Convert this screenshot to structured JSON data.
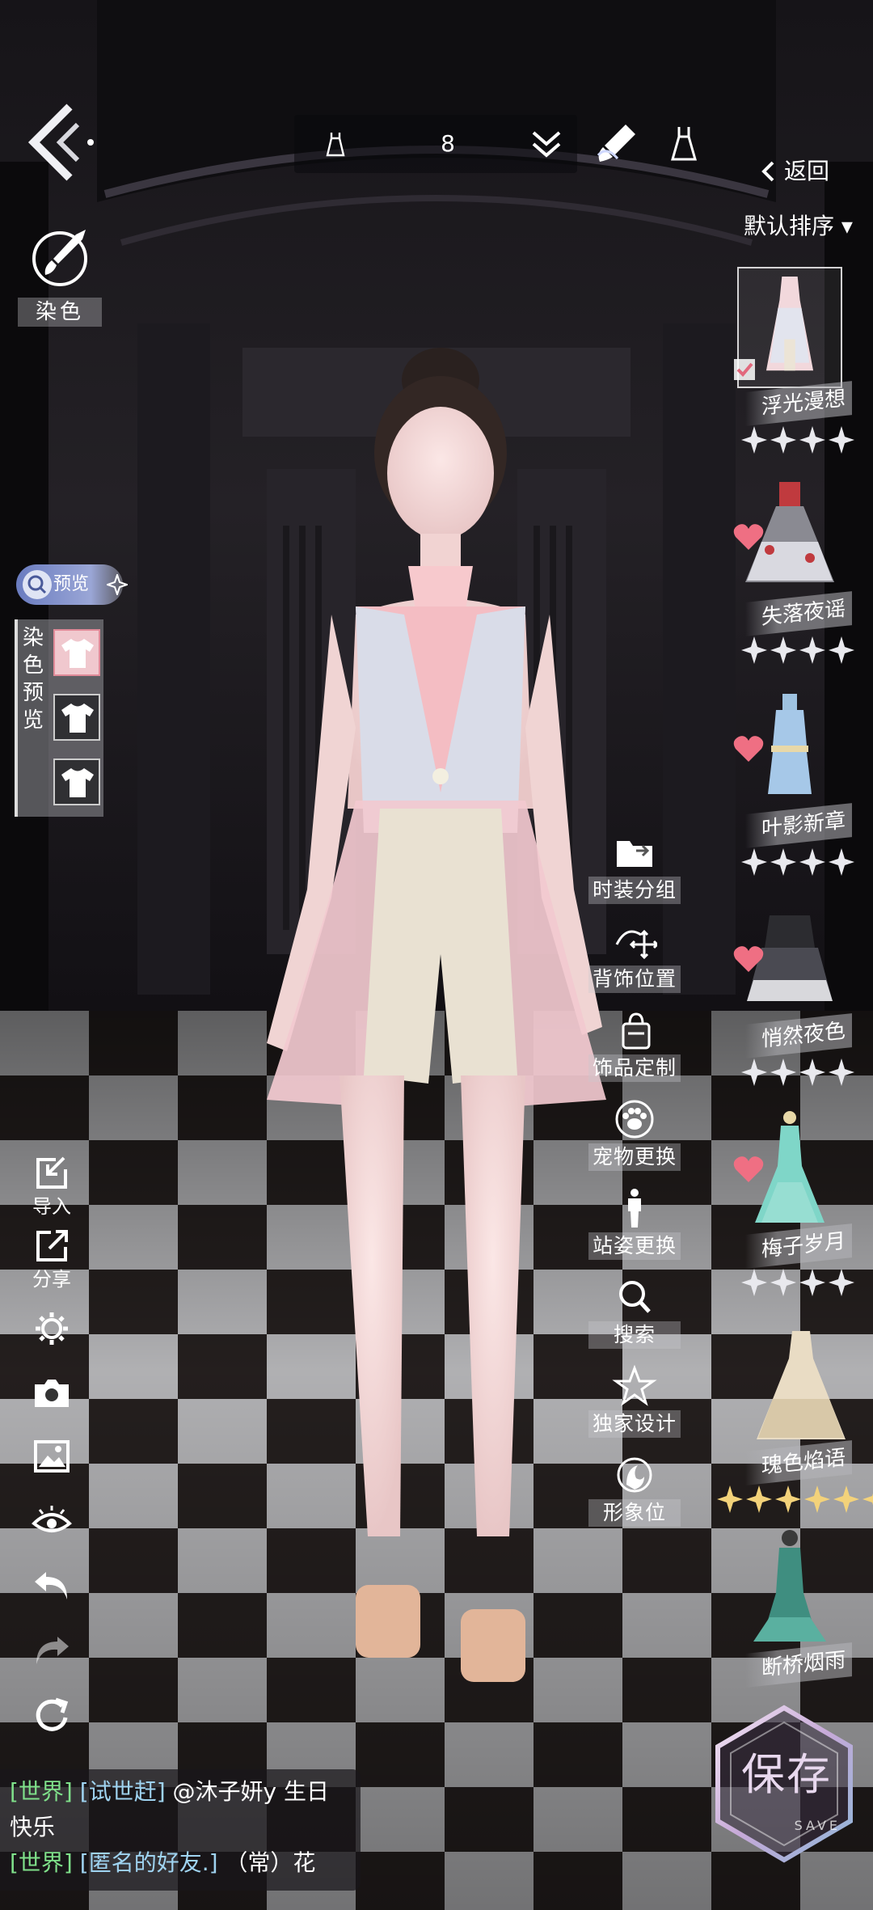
{
  "topbar": {
    "outfit_count": "8",
    "return_label": "返回",
    "sort_label": "默认排序 ▾"
  },
  "dye": {
    "label": "染色",
    "preview_toggle_label": "预览",
    "preview_panel_label": "染色预览"
  },
  "left_tools": [
    {
      "icon": "import-icon",
      "label": "导入"
    },
    {
      "icon": "share-icon",
      "label": "分享"
    },
    {
      "icon": "settings-gear-icon",
      "label": ""
    },
    {
      "icon": "camera-icon",
      "label": ""
    },
    {
      "icon": "picture-icon",
      "label": ""
    },
    {
      "icon": "eye-icon",
      "label": ""
    },
    {
      "icon": "undo-icon",
      "label": ""
    },
    {
      "icon": "redo-icon",
      "label": ""
    },
    {
      "icon": "reset-icon",
      "label": ""
    }
  ],
  "right_menu": [
    {
      "icon": "folder-icon",
      "label": "时装分组"
    },
    {
      "icon": "move-icon",
      "label": "背饰位置"
    },
    {
      "icon": "bag-icon",
      "label": "饰品定制"
    },
    {
      "icon": "paw-icon",
      "label": "宠物更换"
    },
    {
      "icon": "pose-icon",
      "label": "站姿更换"
    },
    {
      "icon": "search-icon",
      "label": "搜索"
    },
    {
      "icon": "star-icon",
      "label": "独家设计"
    },
    {
      "icon": "image-avatar-icon",
      "label": "形象位"
    }
  ],
  "outfits": [
    {
      "name": "浮光漫想",
      "stars": 4,
      "selected": true,
      "favorite": false
    },
    {
      "name": "失落夜谣",
      "stars": 4,
      "selected": false,
      "favorite": true
    },
    {
      "name": "叶影新章",
      "stars": 4,
      "selected": false,
      "favorite": true
    },
    {
      "name": "悄然夜色",
      "stars": 4,
      "selected": false,
      "favorite": true
    },
    {
      "name": "梅子岁月",
      "stars": 4,
      "selected": false,
      "favorite": true
    },
    {
      "name": "瑰色焰语",
      "stars": 6,
      "selected": false,
      "favorite": false
    },
    {
      "name": "断桥烟雨",
      "stars": 0,
      "selected": false,
      "favorite": false
    }
  ],
  "save": {
    "label": "保存",
    "sub": "SAVE"
  },
  "chat": [
    {
      "channel": "[世界]",
      "name": "[试世赶]",
      "text": " @沐子妍y 生日快乐"
    },
    {
      "channel": "[世界]",
      "name": "[匿名的好友.]",
      "text": " （常）花"
    }
  ],
  "colors": {
    "gold_star": "#f3d27a",
    "white_star": "#e9e9ee",
    "heart": "#ef6f83",
    "chat_channel": "#7fe08a"
  }
}
